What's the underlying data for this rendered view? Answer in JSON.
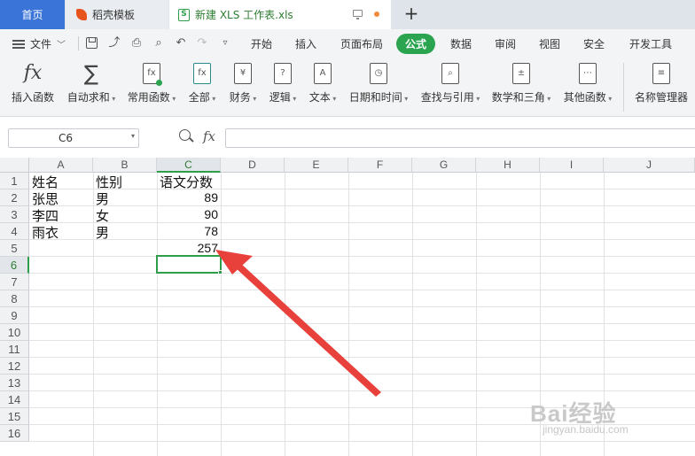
{
  "tabs": {
    "home": "首页",
    "daoke": "稻壳模板",
    "active": "新建 XLS 工作表.xls",
    "new_tab": "+"
  },
  "menu": {
    "file": "文件",
    "tabs": [
      "开始",
      "插入",
      "页面布局",
      "公式",
      "数据",
      "审阅",
      "视图",
      "安全",
      "开发工具"
    ],
    "active_tab": "公式"
  },
  "ribbon": {
    "insert_function": "插入函数",
    "autosum": "自动求和",
    "common_functions": "常用函数",
    "all": "全部",
    "finance": "财务",
    "logic": "逻辑",
    "text": "文本",
    "datetime": "日期和时间",
    "lookup": "查找与引用",
    "math": "数学和三角",
    "other": "其他函数",
    "name_manager": "名称管理器"
  },
  "formula_bar": {
    "name_box": "C6",
    "fx": "fx",
    "formula": ""
  },
  "sheet": {
    "columns": [
      "A",
      "B",
      "C",
      "D",
      "E",
      "F",
      "G",
      "H",
      "I",
      "J"
    ],
    "rows": [
      "1",
      "2",
      "3",
      "4",
      "5",
      "6",
      "7",
      "8",
      "9",
      "10",
      "11",
      "12",
      "13",
      "14",
      "15",
      "16"
    ],
    "selected_column": "C",
    "selected_row": "6",
    "cells": {
      "A1": "姓名",
      "B1": "性别",
      "C1": "语文分数",
      "A2": "张思",
      "B2": "男",
      "C2": "89",
      "A3": "李四",
      "B3": "女",
      "C3": "90",
      "A4": "雨衣",
      "B4": "男",
      "C4": "78",
      "C5": "257"
    }
  },
  "annotation": {
    "arrow_color": "#e8403a"
  },
  "watermark": {
    "brand": "Bai经验",
    "url": "jingyan.baidu.com"
  },
  "colors": {
    "accent_green": "#2aa44f",
    "home_tab_blue": "#3a74d8"
  }
}
